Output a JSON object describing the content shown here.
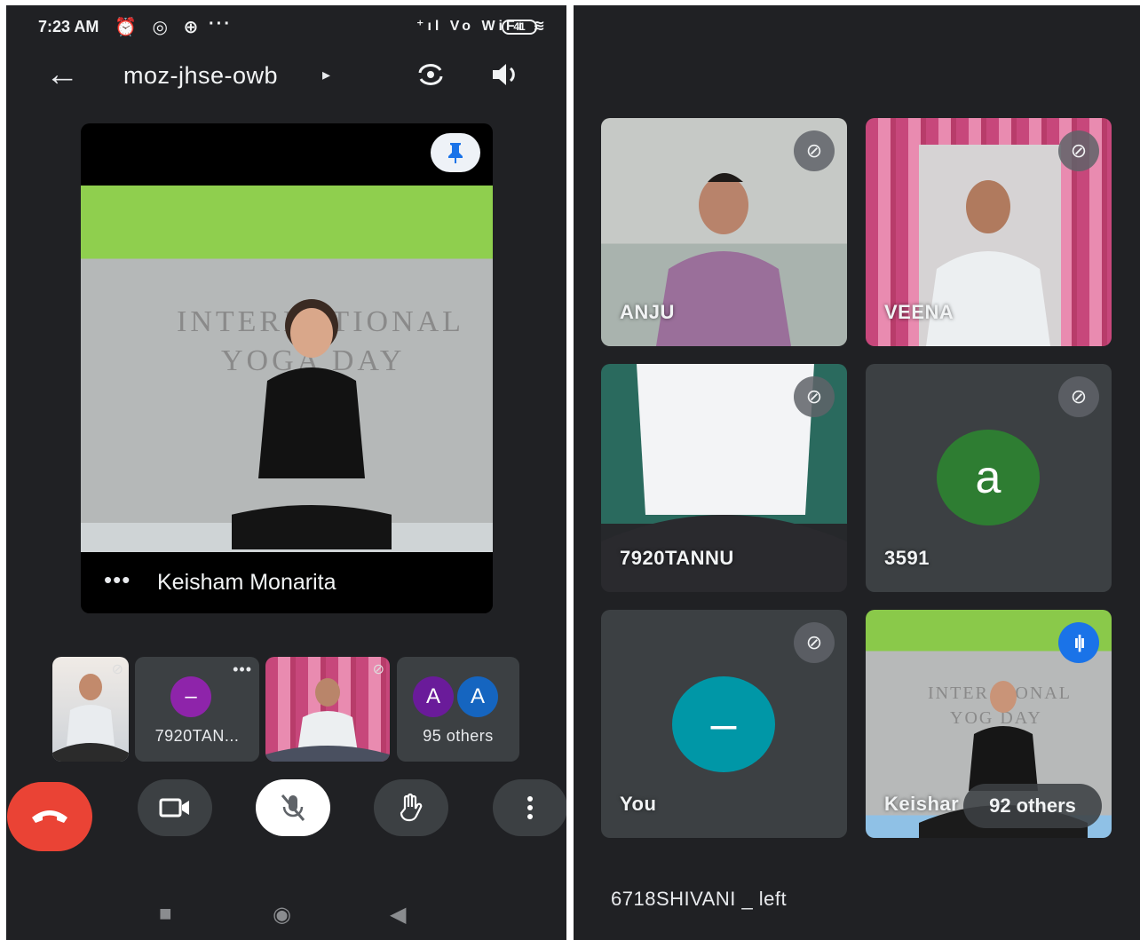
{
  "status_bar": {
    "time": "7:23 AM",
    "left_icons": "⏰ ◎ ⊕",
    "overflow": "···",
    "signal": "⁺ıl Vo WiFi ≋",
    "battery": "41"
  },
  "meeting": {
    "code": "moz-jhse-owb",
    "code_arrow": "▸"
  },
  "pinned": {
    "name": "Keisham Monarita",
    "more": "•••",
    "banner_line1": "INTERNATIONAL",
    "banner_line2": "YOGA DAY"
  },
  "strip": [
    {
      "label": ""
    },
    {
      "label": "7920TAN...",
      "avatar": "–",
      "avatar_color": "#8e24aa"
    },
    {
      "label": ""
    },
    {
      "label": "95 others",
      "avatar_1": "A",
      "avatar_1_color": "#6a1b9a",
      "avatar_2": "A",
      "avatar_2_color": "#1565c0"
    }
  ],
  "grid": [
    {
      "name": "ANJU",
      "muted": true
    },
    {
      "name": "VEENA",
      "muted": true
    },
    {
      "name": "7920TANNU",
      "muted": true
    },
    {
      "name": "3591",
      "muted": true,
      "avatar": "a",
      "avatar_color": "#2e7d32"
    },
    {
      "name": "You",
      "muted": true,
      "avatar": "–",
      "avatar_color": "#0097a7"
    },
    {
      "name": "Keishar",
      "speaking": true,
      "others": "92 others"
    }
  ],
  "left_message": "6718SHIVANI _ left",
  "colors": {
    "background": "#202124",
    "tile": "#3c4043",
    "end_call": "#ea4335",
    "accent": "#1a73e8"
  },
  "icons": {
    "back": "←",
    "camera_switch": "⟲",
    "speaker": "🔈",
    "pin": "⚲",
    "end_call": "☎",
    "camera": "▭",
    "mic_off": "🎙",
    "raise_hand": "✋",
    "more": "⋮",
    "nav_recent": "■",
    "nav_home": "◉",
    "nav_back": "◀"
  }
}
